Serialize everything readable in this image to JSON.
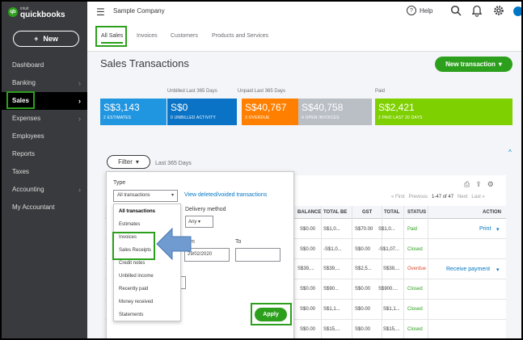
{
  "app": {
    "logo_intuit": "intuit",
    "logo_name": "quickbooks",
    "company": "Sample Company",
    "help": "Help"
  },
  "sidebar": {
    "new_label": "New",
    "items": [
      {
        "label": "Dashboard",
        "chev": ""
      },
      {
        "label": "Banking",
        "chev": "›"
      },
      {
        "label": "Sales",
        "chev": "›"
      },
      {
        "label": "Expenses",
        "chev": "›"
      },
      {
        "label": "Employees",
        "chev": ""
      },
      {
        "label": "Reports",
        "chev": ""
      },
      {
        "label": "Taxes",
        "chev": ""
      },
      {
        "label": "Accounting",
        "chev": "›"
      },
      {
        "label": "My Accountant",
        "chev": ""
      }
    ]
  },
  "tabs": [
    "All Sales",
    "Invoices",
    "Customers",
    "Products and Services"
  ],
  "page": {
    "title": "Sales Transactions",
    "new_transaction": "New transaction"
  },
  "captions": {
    "unbilled": "Unbilled Last 365 Days",
    "unpaid": "Unpaid Last 365 Days",
    "paid": "Paid"
  },
  "cards": [
    {
      "amount": "S$3,143",
      "label": "2 ESTIMATES",
      "color": "#2196e0"
    },
    {
      "amount": "S$0",
      "label": "0 UNBILLED ACTIVITY",
      "color": "#0a73c5"
    },
    {
      "amount": "S$40,767",
      "label": "3 OVERDUE",
      "color": "#ff8000"
    },
    {
      "amount": "S$40,758",
      "label": "4 OPEN INVOICES",
      "color": "#babec5"
    },
    {
      "amount": "S$2,421",
      "label": "2 PAID LAST 30 DAYS",
      "color": "#7fd000"
    }
  ],
  "filter": {
    "button": "Filter",
    "range": "Last 365 Days",
    "type_label": "Type",
    "type_value": "All transactions",
    "view_deleted": "View deleted/voided transactions",
    "delivery_label": "Delivery method",
    "delivery_value": "Any",
    "from_label": "m",
    "from_value": "29/02/2020",
    "to_label": "To",
    "apply": "Apply",
    "type_options": [
      "All transactions",
      "Estimates",
      "Invoices",
      "Sales Receipts",
      "Credit notes",
      "Unbilled income",
      "Recently paid",
      "Money received",
      "Statements"
    ]
  },
  "pager": {
    "first": "« First",
    "previous": "Previous",
    "count": "1-47 of 47",
    "next": "Next",
    "last": "Last »"
  },
  "table": {
    "headers": {
      "balance": "BALANCE",
      "total_before": "TOTAL BE",
      "gst": "GST",
      "total": "TOTAL",
      "status": "STATUS",
      "action": "ACTION"
    },
    "rows": [
      {
        "balance": "S$0.00",
        "total_before": "S$1,0...",
        "gst": "S$70.00",
        "total": "S$1,0...",
        "status": "Paid",
        "action": "Print"
      },
      {
        "balance": "S$0.00",
        "total_before": "-S$1,0...",
        "gst": "S$0.00",
        "total": "-S$1,07...",
        "status": "Closed",
        "action": ""
      },
      {
        "balance": "S$39,...",
        "total_before": "S$39,...",
        "gst": "S$2,5...",
        "total": "S$39,...",
        "status": "Overdue",
        "action": "Receive payment"
      },
      {
        "balance": "S$0.00",
        "total_before": "S$90...",
        "gst": "S$0.00",
        "total": "S$900....",
        "status": "Closed",
        "action": ""
      },
      {
        "balance": "S$0.00",
        "total_before": "S$1,1...",
        "gst": "S$0.00",
        "total": "S$1,1...",
        "status": "Closed",
        "action": ""
      },
      {
        "balance": "S$0.00",
        "total_before": "S$15,...",
        "gst": "S$0.00",
        "total": "S$15,...",
        "status": "Closed",
        "action": ""
      }
    ]
  }
}
